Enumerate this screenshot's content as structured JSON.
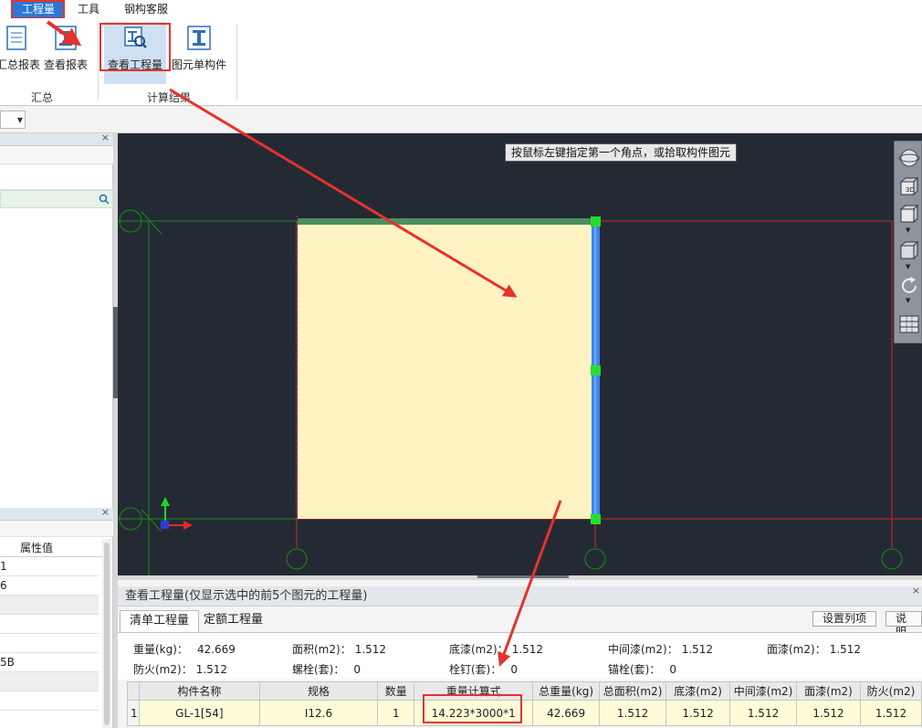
{
  "menu": {
    "items": [
      {
        "label": "工程量",
        "active": true
      },
      {
        "label": "工具",
        "active": false
      },
      {
        "label": "钢构客服",
        "active": false
      }
    ]
  },
  "ribbon": {
    "buttons": [
      {
        "label": "汇总报表",
        "icon": "report-summary-icon"
      },
      {
        "label": "查看报表",
        "icon": "view-report-icon"
      },
      {
        "label": "查看工程量",
        "icon": "view-quantity-icon"
      },
      {
        "label": "图元单构件",
        "icon": "i-beam-icon"
      }
    ],
    "groups": [
      "汇总",
      "计算结果"
    ]
  },
  "canvas": {
    "tooltip": "按鼠标左键指定第一个角点，或拾取构件图元",
    "colors": {
      "background": "#242a33",
      "member_fill": "#fff2c3",
      "selected_edge": "#3f86f0",
      "grip": "#22e02a",
      "axis_line": "#cc2b2b",
      "grid_line": "#1c8a1c"
    },
    "tool_icons": [
      "orbit-icon",
      "view-3d-icon",
      "view-cube-icon",
      "box-icon",
      "rotate-icon",
      "grid-settings-icon"
    ],
    "tool_3d_label": "3D"
  },
  "left_panel": {
    "props_header": "属性值",
    "props_values": [
      "1",
      "6",
      "",
      "",
      "",
      "5B",
      "",
      ""
    ]
  },
  "bottom_panel": {
    "title": "查看工程量(仅显示选中的前5个图元的工程量)",
    "tabs": [
      "清单工程量",
      "定额工程量"
    ],
    "buttons": [
      "设置列项",
      "说明"
    ],
    "summary": [
      [
        {
          "label": "重量(kg)：",
          "value": "42.669"
        },
        {
          "label": "面积(m2)：",
          "value": "1.512"
        },
        {
          "label": "底漆(m2)：",
          "value": "1.512"
        },
        {
          "label": "中间漆(m2)：",
          "value": "1.512"
        },
        {
          "label": "面漆(m2)：",
          "value": "1.512"
        }
      ],
      [
        {
          "label": "防火(m2)：",
          "value": "1.512"
        },
        {
          "label": "螺栓(套)：",
          "value": "0"
        },
        {
          "label": "栓钉(套)：",
          "value": "0"
        },
        {
          "label": "锚栓(套)：",
          "value": "0"
        }
      ]
    ],
    "table": {
      "headers": [
        "",
        "构件名称",
        "规格",
        "数量",
        "重量计算式",
        "总重量(kg)",
        "总面积(m2)",
        "底漆(m2)",
        "中间漆(m2)",
        "面漆(m2)",
        "防火(m2)"
      ],
      "rows": [
        [
          "1",
          "GL-1[54]",
          "I12.6",
          "1",
          "14.223*3000*1",
          "42.669",
          "1.512",
          "1.512",
          "1.512",
          "1.512",
          "1.512"
        ]
      ]
    }
  }
}
